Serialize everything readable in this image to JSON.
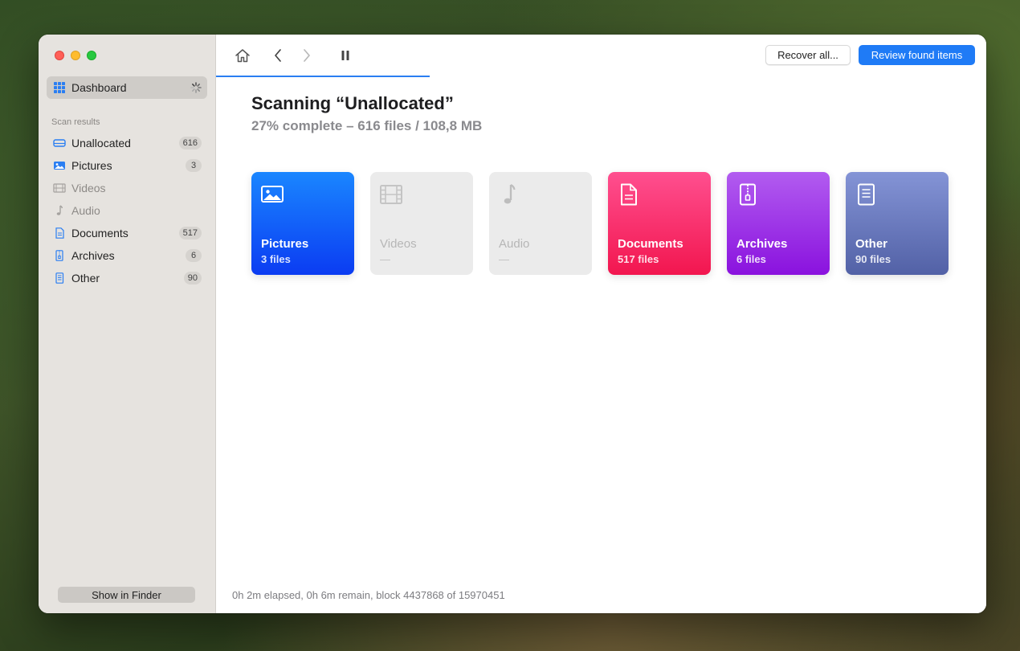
{
  "sidebar": {
    "dashboard_label": "Dashboard",
    "section_title": "Scan results",
    "items": [
      {
        "label": "Unallocated",
        "count": "616",
        "icon": "drive-icon",
        "enabled": true
      },
      {
        "label": "Pictures",
        "count": "3",
        "icon": "picture-icon",
        "enabled": true
      },
      {
        "label": "Videos",
        "count": "",
        "icon": "film-icon",
        "enabled": false
      },
      {
        "label": "Audio",
        "count": "",
        "icon": "music-note-icon",
        "enabled": false
      },
      {
        "label": "Documents",
        "count": "517",
        "icon": "document-icon",
        "enabled": true
      },
      {
        "label": "Archives",
        "count": "6",
        "icon": "archive-icon",
        "enabled": true
      },
      {
        "label": "Other",
        "count": "90",
        "icon": "other-file-icon",
        "enabled": true
      }
    ],
    "show_in_finder_label": "Show in Finder"
  },
  "toolbar": {
    "recover_all_label": "Recover all...",
    "review_label": "Review found items",
    "progress": 0.27
  },
  "main": {
    "title": "Scanning “Unallocated”",
    "subtitle": "27% complete – 616 files / 108,8 MB",
    "cards": [
      {
        "name": "Pictures",
        "count": "3 files",
        "enabled": true
      },
      {
        "name": "Videos",
        "count": "—",
        "enabled": false
      },
      {
        "name": "Audio",
        "count": "—",
        "enabled": false
      },
      {
        "name": "Documents",
        "count": "517 files",
        "enabled": true
      },
      {
        "name": "Archives",
        "count": "6 files",
        "enabled": true
      },
      {
        "name": "Other",
        "count": "90 files",
        "enabled": true
      }
    ],
    "status": "0h 2m elapsed, 0h 6m remain, block 4437868 of 15970451"
  },
  "colors": {
    "accent": "#1f7bf6",
    "pictures": "#0b3cf2",
    "documents": "#f2164f",
    "archives": "#8a12de",
    "other": "#5261a6",
    "disabled": "#ebebeb"
  }
}
